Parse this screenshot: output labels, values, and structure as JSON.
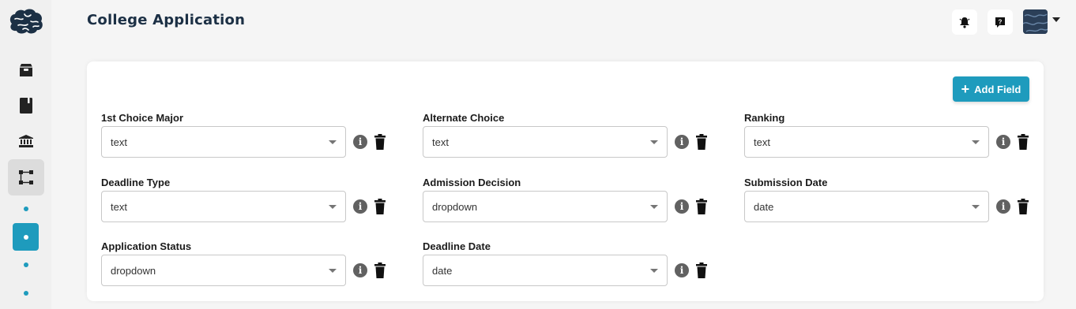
{
  "header": {
    "title": "College Application"
  },
  "actions": {
    "add_field_label": "Add Field"
  },
  "fields": [
    {
      "label": "1st Choice Major",
      "value": "text"
    },
    {
      "label": "Alternate Choice",
      "value": "text"
    },
    {
      "label": "Ranking",
      "value": "text"
    },
    {
      "label": "Deadline Type",
      "value": "text"
    },
    {
      "label": "Admission Decision",
      "value": "dropdown"
    },
    {
      "label": "Submission Date",
      "value": "date"
    },
    {
      "label": "Application Status",
      "value": "dropdown"
    },
    {
      "label": "Deadline Date",
      "value": "date"
    }
  ],
  "sidebar": {
    "items": [
      {
        "icon": "archive-icon"
      },
      {
        "icon": "book-icon"
      },
      {
        "icon": "bank-icon"
      },
      {
        "icon": "workflow-icon",
        "active": true
      }
    ]
  },
  "colors": {
    "accent": "#1e9bbd",
    "title": "#1c3045"
  }
}
